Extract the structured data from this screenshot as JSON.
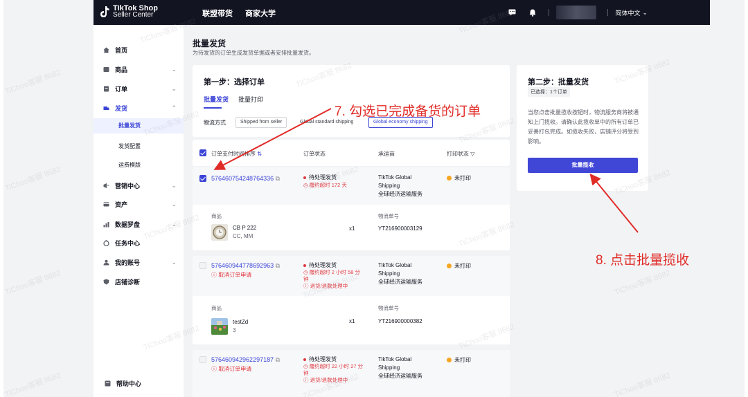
{
  "topbar": {
    "brand_line1": "TikTok Shop",
    "brand_line2": "Seller Center",
    "nav": [
      "联盟带货",
      "商家大学"
    ],
    "language": "简体中文"
  },
  "sidebar": {
    "items": [
      {
        "label": "首页",
        "icon": "home-icon"
      },
      {
        "label": "商品",
        "icon": "product-icon"
      },
      {
        "label": "订单",
        "icon": "order-icon"
      },
      {
        "label": "发货",
        "icon": "shipping-icon"
      },
      {
        "label": "营销中心",
        "icon": "marketing-icon"
      },
      {
        "label": "资产",
        "icon": "wallet-icon"
      },
      {
        "label": "数据罗盘",
        "icon": "chart-icon"
      },
      {
        "label": "任务中心",
        "icon": "task-icon"
      },
      {
        "label": "我的账号",
        "icon": "user-icon"
      },
      {
        "label": "店铺诊断",
        "icon": "diagnosis-icon"
      }
    ],
    "shipping_sub": [
      "批量发货",
      "发货配置",
      "运费模版"
    ],
    "help": "帮助中心"
  },
  "page": {
    "title": "批量发货",
    "subtitle": "为待发货的订单生成发货单据或者安排批量发货。"
  },
  "step1": {
    "title": "第一步：选择订单",
    "tabs": [
      "批量发货",
      "批量打印"
    ],
    "shipping_label": "物流方式",
    "shipping_options": [
      "Shipped from seller",
      "Global standard shipping",
      "Global economy shipping"
    ]
  },
  "table": {
    "headers": [
      "订单支付时间排序",
      "订单状态",
      "承运商",
      "打印状态"
    ],
    "product_label": "商品",
    "tracking_label": "物流单号"
  },
  "orders": [
    {
      "id": "576460754248764336",
      "status": "待处理发货",
      "sla": [
        "履约超时 172 天"
      ],
      "carrier": [
        "TikTok Global",
        "Shipping",
        "全球经济运输服务"
      ],
      "print_status": "未打印",
      "product_name": "CB P 222",
      "product_variant": "CC, MM",
      "qty": "x1",
      "tracking": "YT216900003129"
    },
    {
      "id": "576460944778692963",
      "cancel": "取消订单申请",
      "status": "待处理发货",
      "sla": [
        "履约超时 2 小时 58 分",
        "钟",
        "退货/退款处理中"
      ],
      "carrier": [
        "TikTok Global",
        "Shipping",
        "全球经济运输服务"
      ],
      "print_status": "未打印",
      "product_name": "testZd",
      "product_variant": "3",
      "qty": "x1",
      "tracking": "YT216900000382"
    },
    {
      "id": "576460942962297187",
      "cancel": "取消订单申请",
      "status": "待处理发货",
      "sla": [
        "履约超时 22 小时 27 分",
        "钟",
        "退货/退款处理中"
      ],
      "carrier": [
        "TikTok Global",
        "Shipping",
        "全球经济运输服务"
      ],
      "print_status": "未打印"
    }
  ],
  "step2": {
    "title": "第二步：批量发货",
    "selected": "已选择：1个订单",
    "desc": "当您点击批量揽收按钮时，物流服务商将被通知上门揽收。请确认此揽收单中的所有订单已妥善打包完成。如揽收失败，店铺评分将受到影响。",
    "button": "批量揽收"
  },
  "annotations": {
    "a7": "7. 勾选已完成备货的订单",
    "a8": "8. 点击批量揽收",
    "color": "#e02b27"
  },
  "watermark": "TiChoo客服 8682",
  "colors": {
    "accent": "#3b44d6",
    "topbar": "#121421",
    "danger": "#e0383e",
    "warning": "#f5a623"
  }
}
